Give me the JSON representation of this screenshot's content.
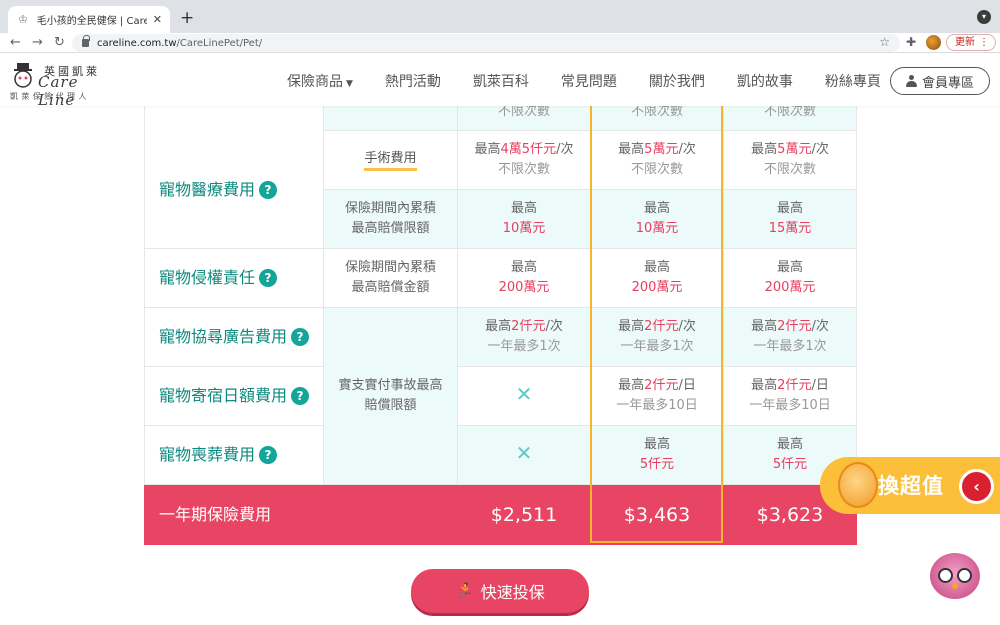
{
  "browser": {
    "tab_title": "毛小孩的全民健保 | Care Line 凱",
    "url_host": "careline.com.tw",
    "url_path": "/CareLinePet/Pet/",
    "update_label": "更新"
  },
  "site": {
    "logo_cn": "英國凱萊",
    "logo_en": "Care Line",
    "logo_sub": "凱萊保險代理人",
    "nav": [
      "保險商品",
      "熱門活動",
      "凱萊百科",
      "常見問題",
      "關於我們",
      "凱的故事",
      "粉絲專頁"
    ],
    "member_label": "會員專區"
  },
  "table": {
    "row0": {
      "c1": "不限次數",
      "c2": "不限次數",
      "c3": "不限次數"
    },
    "medical": {
      "category": "寵物醫療費用",
      "surgery": {
        "label": "手術費用",
        "c1_pre": "最高",
        "c1_amt": "4萬5仟元",
        "c1_suf": "/次",
        "c2_pre": "最高",
        "c2_amt": "5萬元",
        "c2_suf": "/次",
        "c3_pre": "最高",
        "c3_amt": "5萬元",
        "c3_suf": "/次",
        "note": "不限次數"
      },
      "cumulative": {
        "label_line1": "保險期間內累積",
        "label_line2": "最高賠償限額",
        "prefix": "最高",
        "c1": "10萬元",
        "c2": "10萬元",
        "c3": "15萬元"
      }
    },
    "liability": {
      "category": "寵物侵權責任",
      "label_line1": "保險期間內累積",
      "label_line2": "最高賠償金額",
      "prefix": "最高",
      "c1": "200萬元",
      "c2": "200萬元",
      "c3": "200萬元"
    },
    "group_label_line1": "實支實付事故最高",
    "group_label_line2": "賠償限額",
    "search_ad": {
      "category": "寵物協尋廣告費用",
      "pre": "最高",
      "amt": "2仟元",
      "suf": "/次",
      "note": "一年最多1次"
    },
    "boarding": {
      "category": "寵物寄宿日額費用",
      "pre": "最高",
      "amt": "2仟元",
      "suf": "/日",
      "note": "一年最多10日"
    },
    "funeral": {
      "category": "寵物喪葬費用",
      "prefix": "最高",
      "c2": "5仟元",
      "c3": "5仟元"
    },
    "total": {
      "label": "一年期保險費用",
      "c1": "$2,511",
      "c2": "$3,463",
      "c3": "$3,623"
    }
  },
  "promo_label": "換超值",
  "cta_label": "快速投保",
  "colors": {
    "accent_red": "#e84565",
    "teal": "#0d8a7e",
    "highlight": "#f5b52e"
  }
}
